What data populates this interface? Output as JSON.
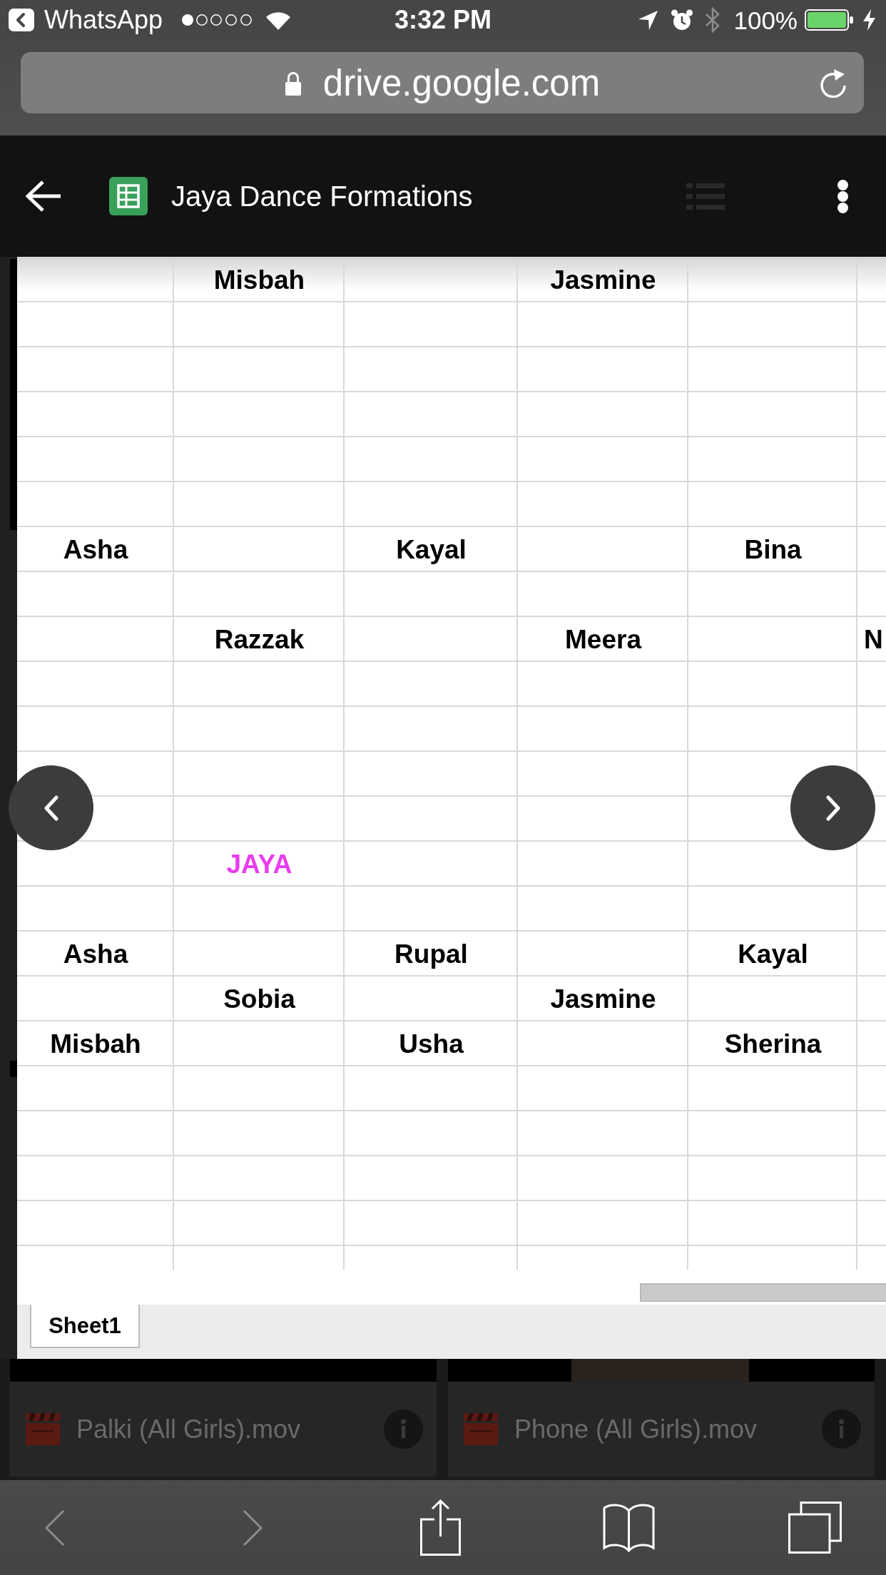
{
  "status_bar": {
    "back_to_app": "WhatsApp",
    "time": "3:32 PM",
    "battery": "100%"
  },
  "address_bar": {
    "url": "drive.google.com"
  },
  "viewer_header": {
    "title": "Jaya Dance Formations"
  },
  "sheet": {
    "rows": [
      {
        "column_2": {
          "text": "Misbah"
        },
        "column_4": {
          "text": "Jasmine"
        }
      },
      {},
      {},
      {},
      {},
      {},
      {
        "column_1": {
          "text": "Asha"
        },
        "column_3": {
          "text": "Kayal"
        },
        "column_5": {
          "text": "Bina"
        }
      },
      {},
      {
        "column_2": {
          "text": "Razzak"
        },
        "column_4": {
          "text": "Meera"
        },
        "column_6": {
          "text": "N"
        }
      },
      {},
      {},
      {},
      {},
      {
        "column_2": {
          "text": "JAYA",
          "color": "#ea3cf0"
        }
      },
      {},
      {
        "column_1": {
          "text": "Asha"
        },
        "column_3": {
          "text": "Rupal"
        },
        "column_5": {
          "text": "Kayal"
        }
      },
      {
        "column_2": {
          "text": "Sobia"
        },
        "column_4": {
          "text": "Jasmine"
        }
      },
      {
        "column_1": {
          "text": "Misbah"
        },
        "column_3": {
          "text": "Usha"
        },
        "column_5": {
          "text": "Sherina"
        }
      },
      {},
      {},
      {},
      {},
      {}
    ],
    "tabs": [
      {
        "label": "Sheet1",
        "selected": true
      }
    ]
  },
  "background_files": [
    {
      "name": "Palki (All Girls).mov"
    },
    {
      "name": "Phone (All Girls).mov"
    }
  ],
  "toolbar": {
    "back": {
      "disabled": true
    },
    "forward": {
      "disabled": true
    }
  }
}
